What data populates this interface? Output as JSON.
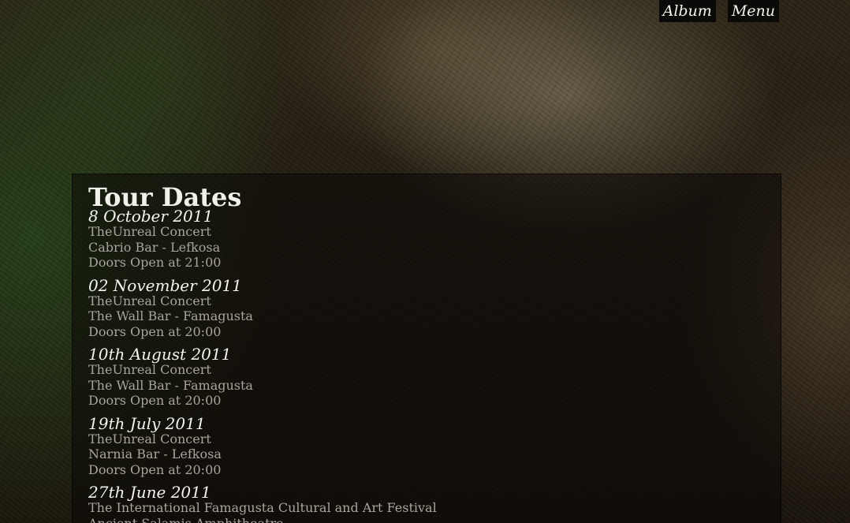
{
  "nav": {
    "album_label": "Album",
    "menu_label": "Menu"
  },
  "page": {
    "title": "Tour Dates"
  },
  "events": [
    {
      "date": "8 October 2011",
      "lines": [
        "TheUnreal Concert",
        "Cabrio Bar - Lefkosa",
        "Doors Open at 21:00"
      ]
    },
    {
      "date": "02 November 2011",
      "lines": [
        "TheUnreal Concert",
        "The Wall Bar - Famagusta",
        "Doors Open at 20:00"
      ]
    },
    {
      "date": "10th August 2011",
      "lines": [
        "TheUnreal Concert",
        "The Wall Bar - Famagusta",
        "Doors Open at 20:00"
      ]
    },
    {
      "date": "19th July 2011",
      "lines": [
        "TheUnreal Concert",
        "Narnia Bar - Lefkosa",
        "Doors Open at 20:00"
      ]
    },
    {
      "date": "27th June 2011",
      "lines": [
        "The International Famagusta Cultural and Art Festival",
        "Ancient Salamis Amphitheatre,"
      ]
    }
  ]
}
